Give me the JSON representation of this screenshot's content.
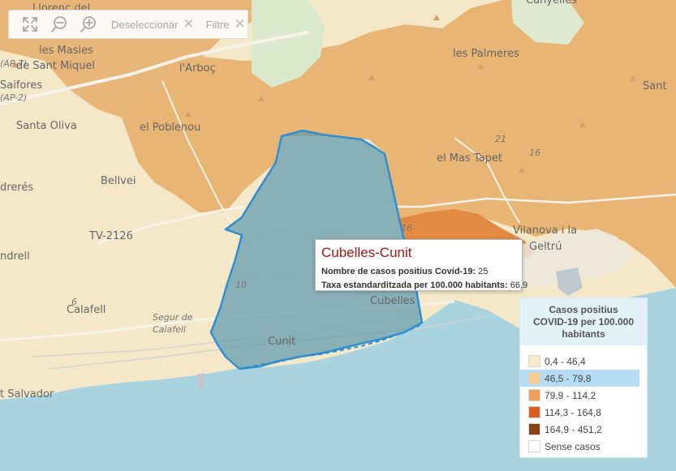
{
  "toolbar": {
    "buttons": [
      {
        "icon": "fullscreen-icon"
      },
      {
        "icon": "zoom-out-icon"
      },
      {
        "icon": "zoom-in-icon"
      }
    ],
    "deselect_label": "Deseleccionar",
    "filter_label": "Filtre",
    "clear_glyph": "✕"
  },
  "map": {
    "places": [
      "Llorenç del",
      "les Masies",
      "de Sant Miquel",
      "l'Arboç",
      "Saifores",
      "Santa Oliva",
      "el Poblenou",
      "Bellvei",
      "drerés",
      "TV-2126",
      "ndrell",
      "Calafell",
      "Segur de",
      "Calafell",
      "Cubelles",
      "Cunit",
      "les Palmeres",
      "el Mas Tapet",
      "Vilanova i la",
      "Geltrú",
      "Sant",
      "Canyelles",
      "t Salvador",
      "(AP-7)",
      "(AP-2)",
      "16",
      "10",
      "21",
      "6",
      "16"
    ],
    "selected_region": "Cubelles-Cunit",
    "colors": {
      "sea": "#a9d3df",
      "land_light": "#f4e8c8",
      "land_orange": "#e8b575",
      "selection_fill": "#5f99b0",
      "selection_border": "#2f8fd1"
    }
  },
  "popup": {
    "title": "Cubelles-Cunit",
    "cases_label": "Nombre de casos positius Covid-19:",
    "cases_value": "25",
    "rate_label": "Taxa estandarditzada per 100.000 habitants:",
    "rate_value": "66,9"
  },
  "legend": {
    "title_lines": [
      "Casos positius",
      "COVID-19 per 100.000",
      "habitants"
    ],
    "items": [
      {
        "label": "0,4 - 46,4",
        "color": "#f8ebc8",
        "selected": false
      },
      {
        "label": "46,5 - 79,8",
        "color": "#f5cf92",
        "selected": true
      },
      {
        "label": "79,9 - 114,2",
        "color": "#ee9f58",
        "selected": false
      },
      {
        "label": "114,3 - 164,8",
        "color": "#d9601c",
        "selected": false
      },
      {
        "label": "164,9 - 451,2",
        "color": "#8a4010",
        "selected": false
      },
      {
        "label": "Sense casos",
        "color": "#ffffff",
        "selected": false
      }
    ]
  }
}
